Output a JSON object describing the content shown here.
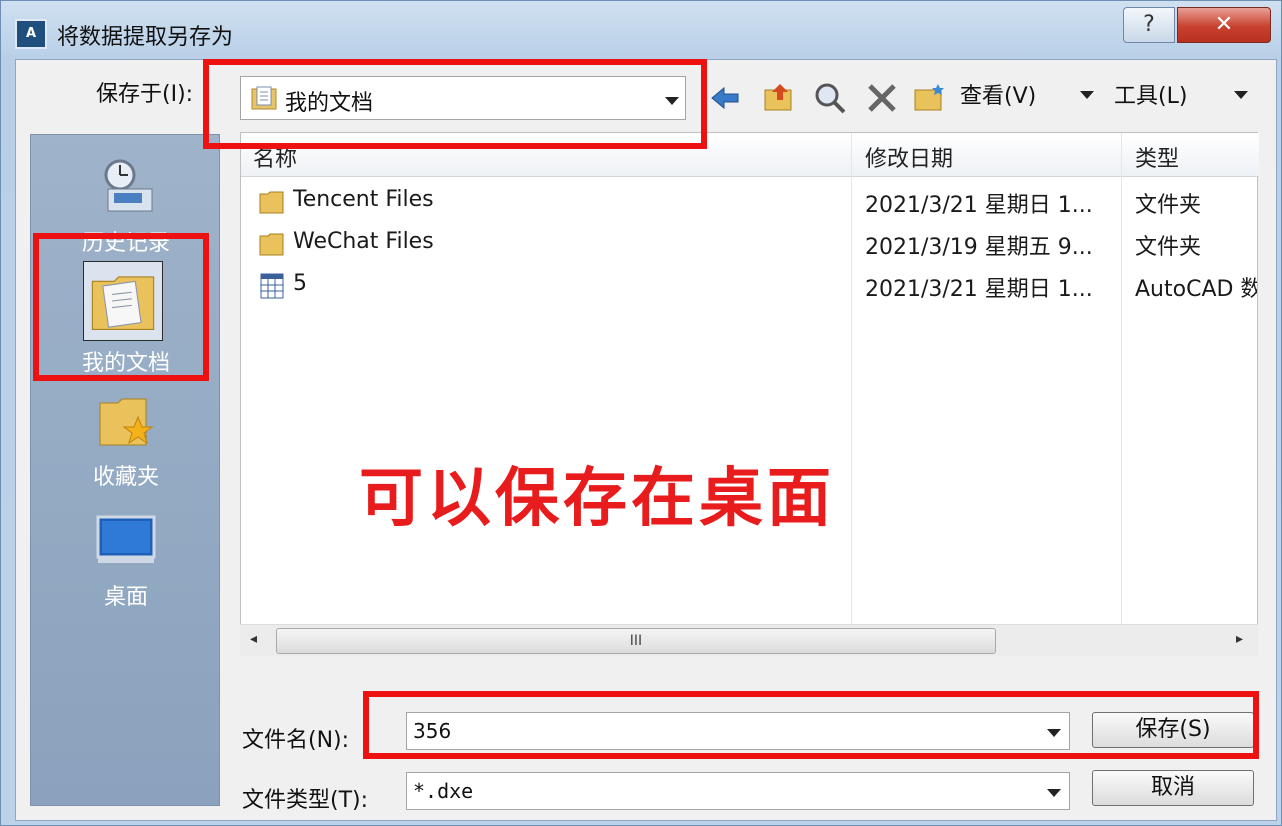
{
  "window": {
    "title": "将数据提取另存为",
    "app_icon_text": "A",
    "help_label": "?",
    "close_label": "✕"
  },
  "toolbar": {
    "save_in_label": "保存于(I):",
    "location_value": "我的文档",
    "back_icon": "back-arrow-icon",
    "up_folder_icon": "up-folder-icon",
    "search_web_icon": "search-web-icon",
    "delete_icon": "delete-icon",
    "new_folder_icon": "new-folder-icon",
    "view_menu": "查看(V)",
    "tools_menu": "工具(L)"
  },
  "places": {
    "items": [
      {
        "label": "历史记录",
        "icon": "history-icon"
      },
      {
        "label": "我的文档",
        "icon": "my-documents-icon"
      },
      {
        "label": "收藏夹",
        "icon": "favorites-icon"
      },
      {
        "label": "桌面",
        "icon": "desktop-icon"
      }
    ]
  },
  "file_list": {
    "columns": [
      "名称",
      "修改日期",
      "类型"
    ],
    "rows": [
      {
        "name": "Tencent Files",
        "date": "2021/3/21 星期日 1...",
        "type": "文件夹",
        "icon": "folder-icon"
      },
      {
        "name": "WeChat Files",
        "date": "2021/3/19 星期五 9...",
        "type": "文件夹",
        "icon": "folder-icon"
      },
      {
        "name": "5",
        "date": "2021/3/21 星期日 1...",
        "type": "AutoCAD 数",
        "icon": "spreadsheet-file-icon"
      }
    ],
    "scroll_grip": "III"
  },
  "bottom": {
    "filename_label": "文件名(N):",
    "filename_value": "356",
    "filetype_label": "文件类型(T):",
    "filetype_value": "*.dxe",
    "save_button": "保存(S)",
    "cancel_button": "取消"
  },
  "annotation": {
    "text": "可以保存在桌面",
    "color": "#e81c1c"
  }
}
